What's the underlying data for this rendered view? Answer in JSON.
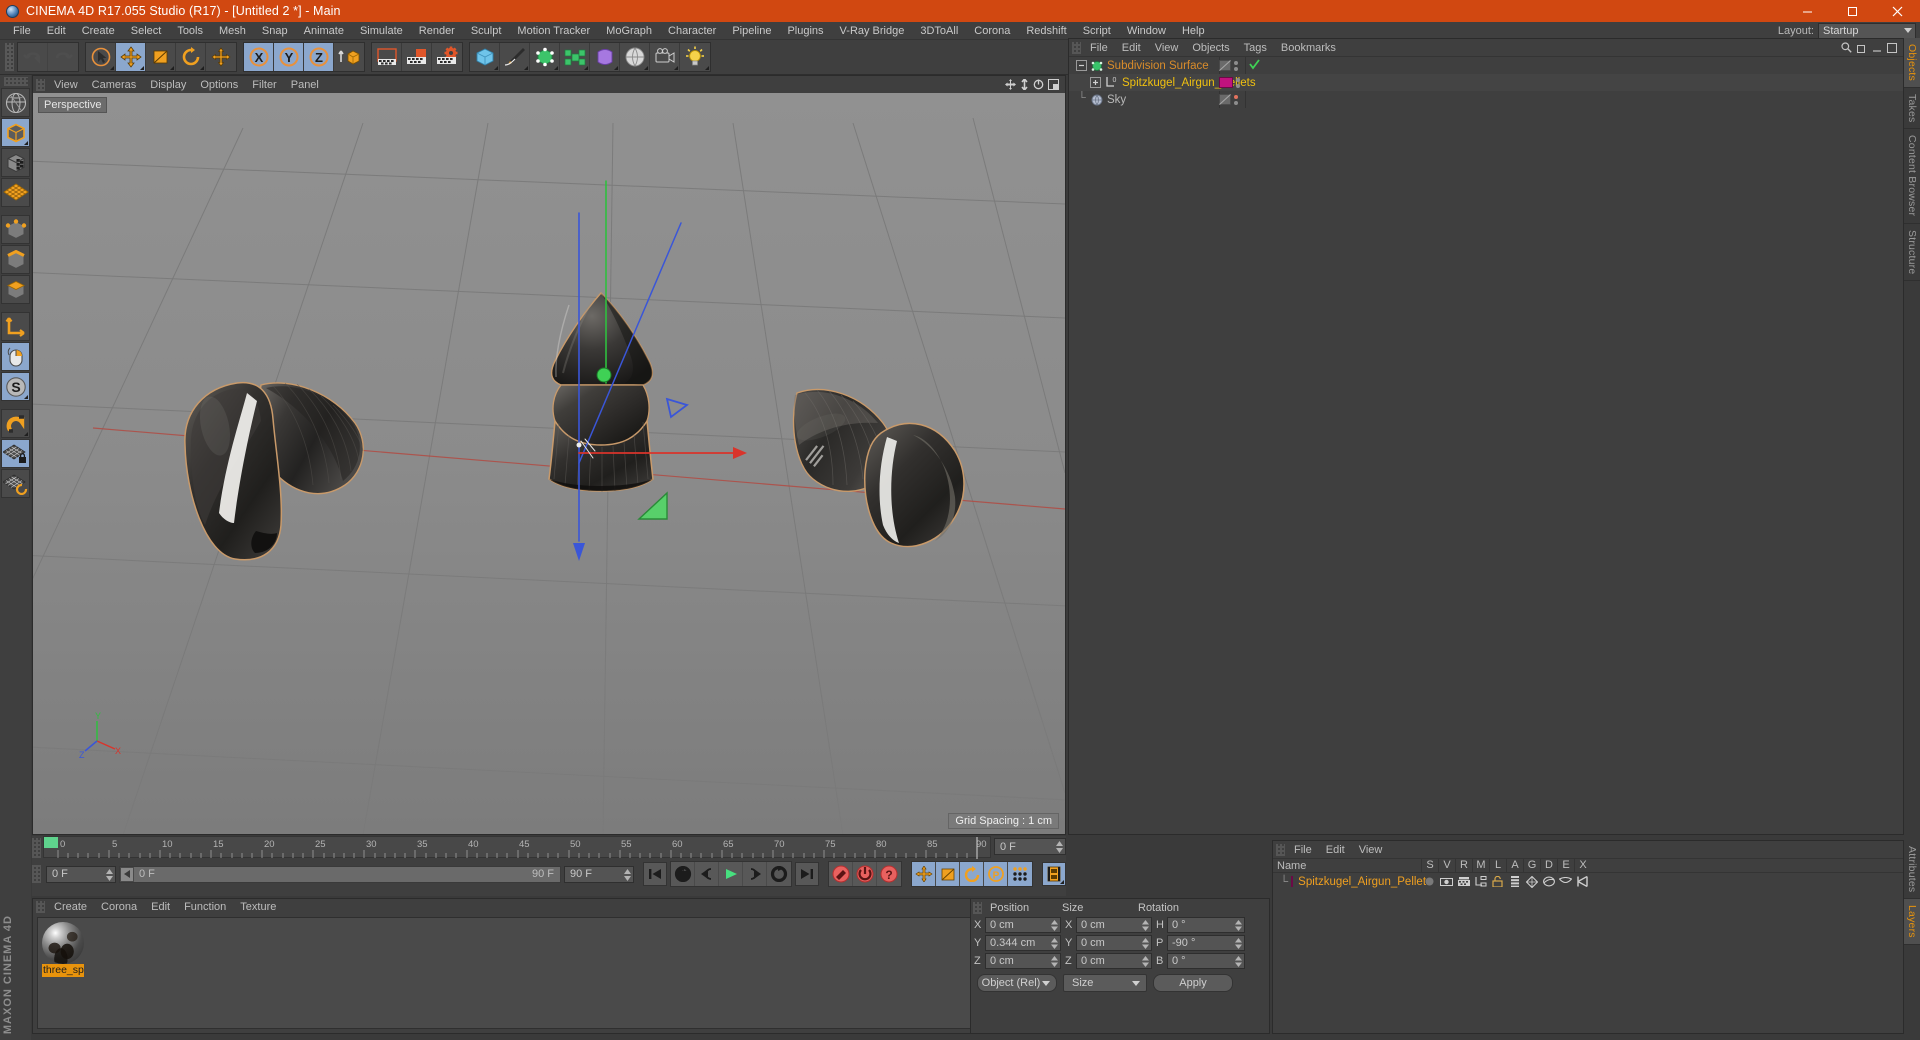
{
  "window": {
    "title": "CINEMA 4D R17.055 Studio (R17) - [Untitled 2 *] - Main",
    "logo_icon": "cinema4d-logo-icon",
    "minimize_icon": "minimize-icon",
    "maximize_icon": "maximize-icon",
    "close_icon": "close-icon",
    "titlebar_color": "#d14811"
  },
  "menubar": {
    "items": [
      {
        "label": "File"
      },
      {
        "label": "Edit"
      },
      {
        "label": "Create"
      },
      {
        "label": "Select"
      },
      {
        "label": "Tools"
      },
      {
        "label": "Mesh"
      },
      {
        "label": "Snap"
      },
      {
        "label": "Animate"
      },
      {
        "label": "Simulate"
      },
      {
        "label": "Render"
      },
      {
        "label": "Sculpt"
      },
      {
        "label": "Motion Tracker"
      },
      {
        "label": "MoGraph"
      },
      {
        "label": "Character"
      },
      {
        "label": "Pipeline"
      },
      {
        "label": "Plugins"
      },
      {
        "label": "V-Ray Bridge"
      },
      {
        "label": "3DToAll"
      },
      {
        "label": "Corona"
      },
      {
        "label": "Redshift"
      },
      {
        "label": "Script"
      },
      {
        "label": "Window"
      },
      {
        "label": "Help"
      }
    ],
    "layout_label": "Layout:",
    "layout_value": "Startup"
  },
  "toolbar": {
    "groups": [
      {
        "buttons": [
          {
            "name": "undo-button",
            "icon": "undo-icon",
            "selected": false,
            "dim": true
          },
          {
            "name": "redo-button",
            "icon": "redo-icon",
            "selected": false,
            "dim": true
          }
        ]
      },
      {
        "buttons": [
          {
            "name": "live-selection-tool",
            "icon": "cursor-circle-icon",
            "selected": false
          },
          {
            "name": "move-tool",
            "icon": "move-arrows-icon",
            "selected": true
          },
          {
            "name": "scale-tool",
            "icon": "scale-box-icon",
            "selected": false
          },
          {
            "name": "rotate-tool",
            "icon": "rotate-icon",
            "selected": false
          },
          {
            "name": "move-alt-tool",
            "icon": "move-arrows-icon",
            "selected": false
          }
        ]
      },
      {
        "buttons": [
          {
            "name": "lock-x-axis-button",
            "icon": "axis-x-icon",
            "selected": true
          },
          {
            "name": "lock-y-axis-button",
            "icon": "axis-y-icon",
            "selected": true
          },
          {
            "name": "lock-z-axis-button",
            "icon": "axis-z-icon",
            "selected": true
          },
          {
            "name": "world-object-coordinates-button",
            "icon": "world-cube-icon",
            "selected": false
          }
        ]
      },
      {
        "buttons": [
          {
            "name": "render-view-button",
            "icon": "render-clapper-icon",
            "selected": false
          },
          {
            "name": "render-to-picture-viewer-button",
            "icon": "render-picture-icon",
            "selected": false
          },
          {
            "name": "render-settings-button",
            "icon": "render-settings-icon",
            "selected": false
          }
        ]
      },
      {
        "buttons": [
          {
            "name": "add-cube-button",
            "icon": "cube-icon",
            "selected": false
          },
          {
            "name": "add-spline-button",
            "icon": "pen-spline-icon",
            "selected": false
          },
          {
            "name": "add-generator-button",
            "icon": "generator-icon",
            "selected": false
          },
          {
            "name": "add-array-button",
            "icon": "array-icon",
            "selected": false
          },
          {
            "name": "add-deformer-button",
            "icon": "deformer-icon",
            "selected": false
          },
          {
            "name": "add-environment-button",
            "icon": "environment-icon",
            "selected": false
          },
          {
            "name": "add-camera-button",
            "icon": "camera-icon",
            "selected": false
          },
          {
            "name": "add-light-button",
            "icon": "light-bulb-icon",
            "selected": false
          }
        ]
      }
    ]
  },
  "left_tools": {
    "buttons": [
      {
        "name": "make-editable-button",
        "icon": "globe-wire-icon",
        "selected": false
      },
      {
        "name": "model-mode-button",
        "icon": "model-cube-icon",
        "selected": true
      },
      {
        "name": "texture-mode-button",
        "icon": "texture-cube-icon",
        "selected": false
      },
      {
        "name": "workplane-mode-button",
        "icon": "workplane-grid-icon",
        "selected": false
      },
      {
        "name": "point-mode-button",
        "icon": "points-cube-icon",
        "selected": false
      },
      {
        "name": "edge-mode-button",
        "icon": "edge-cube-icon",
        "selected": false
      },
      {
        "name": "polygon-mode-button",
        "icon": "polygon-cube-icon",
        "selected": false
      },
      {
        "name": "axis-mode-button",
        "icon": "axis-corner-icon",
        "selected": false
      },
      {
        "name": "viewport-solo-button",
        "icon": "mouse-icon",
        "selected": true
      },
      {
        "name": "scale-snap-button",
        "icon": "s-circle-icon",
        "selected": true
      },
      {
        "name": "magnet-tool-button",
        "icon": "magnet-icon",
        "selected": false
      },
      {
        "name": "workplane-lock-button",
        "icon": "grid-lock-icon",
        "selected": true
      },
      {
        "name": "workplane-rotate-button",
        "icon": "grid-rotate-icon",
        "selected": false
      }
    ],
    "brand": "MAXON CINEMA 4D"
  },
  "viewport": {
    "menu_items": [
      {
        "label": "View"
      },
      {
        "label": "Cameras"
      },
      {
        "label": "Display"
      },
      {
        "label": "Options"
      },
      {
        "label": "Filter"
      },
      {
        "label": "Panel"
      }
    ],
    "label": "Perspective",
    "grid_spacing": "Grid Spacing : 1 cm",
    "axis_labels": {
      "y": "Y",
      "x": "X",
      "z": "Z"
    },
    "corner_icons": [
      "viewport-move-icon",
      "viewport-zoom-icon",
      "viewport-rotate-icon",
      "viewport-maximize-icon"
    ]
  },
  "object_manager": {
    "menu_items": [
      {
        "label": "File"
      },
      {
        "label": "Edit"
      },
      {
        "label": "View"
      },
      {
        "label": "Objects"
      },
      {
        "label": "Tags"
      },
      {
        "label": "Bookmarks"
      }
    ],
    "header_icons": [
      "search-icon",
      "window-restore-icon",
      "window-minimize-icon",
      "window-maximize-icon"
    ],
    "rows": [
      {
        "name": "Subdivision Surface",
        "icon": "subdivision-surface-icon",
        "color": "#d98c2b",
        "indent": 6,
        "expanded": true,
        "tag_color": "none",
        "check": true
      },
      {
        "name": "Spitzkugel_Airgun_Pellets",
        "icon": "object-layer0-icon",
        "color": "#f0c010",
        "indent": 22,
        "expanded": false,
        "tag_color": "#c0127e",
        "check": false
      },
      {
        "name": "Sky",
        "icon": "sky-sphere-icon",
        "color": "#b8b8b8",
        "indent": 22,
        "expanded": false,
        "tag_color": "none",
        "check": false
      }
    ]
  },
  "timeline": {
    "ruler_ticks": [
      0,
      5,
      10,
      15,
      20,
      25,
      30,
      35,
      40,
      45,
      50,
      55,
      60,
      65,
      70,
      75,
      80,
      85,
      90
    ],
    "current_frame_field": "0 F",
    "end_frame_field": "90 F",
    "preview_range_field": "90 F",
    "scrub_value": "0 F",
    "transport_buttons": [
      {
        "name": "go-to-start-button",
        "icon": "skip-start-icon"
      },
      {
        "name": "previous-keyframe-button",
        "icon": "prev-key-icon"
      },
      {
        "name": "step-back-button",
        "icon": "step-back-icon"
      },
      {
        "name": "play-button",
        "icon": "play-icon"
      },
      {
        "name": "step-forward-button",
        "icon": "step-forward-icon"
      },
      {
        "name": "next-keyframe-button",
        "icon": "next-key-icon"
      },
      {
        "name": "go-to-end-button",
        "icon": "skip-end-icon"
      }
    ],
    "record_buttons": [
      {
        "name": "record-active-objects-button",
        "icon": "record-key-icon"
      },
      {
        "name": "autokeying-button",
        "icon": "autokey-icon"
      },
      {
        "name": "keyframe-selection-button",
        "icon": "key-question-icon"
      }
    ],
    "key_mode_buttons": [
      {
        "name": "position-key-button",
        "icon": "position-key-icon",
        "selected": true
      },
      {
        "name": "scale-key-button",
        "icon": "scale-key-icon",
        "selected": true
      },
      {
        "name": "rotation-key-button",
        "icon": "rotation-key-icon",
        "selected": true
      },
      {
        "name": "parameter-key-button",
        "icon": "param-key-icon",
        "selected": true
      },
      {
        "name": "point-level-animation-button",
        "icon": "pla-dots-icon",
        "selected": true
      }
    ],
    "extra_button": {
      "name": "timeline-button",
      "icon": "timeline-film-icon"
    }
  },
  "material_manager": {
    "menu_items": [
      {
        "label": "Create"
      },
      {
        "label": "Corona"
      },
      {
        "label": "Edit"
      },
      {
        "label": "Function"
      },
      {
        "label": "Texture"
      }
    ],
    "materials": [
      {
        "name": "three_sp",
        "full_name": "three_sp",
        "preview_icon": "material-sphere-preview",
        "selected": true
      }
    ]
  },
  "coordinates": {
    "columns": [
      "Position",
      "Size",
      "Rotation"
    ],
    "rows": [
      {
        "p_label": "X",
        "p_value": "0 cm",
        "s_label": "X",
        "s_value": "0 cm",
        "r_label": "H",
        "r_value": "0 °"
      },
      {
        "p_label": "Y",
        "p_value": "0.344 cm",
        "s_label": "Y",
        "s_value": "0 cm",
        "r_label": "P",
        "r_value": "-90 °"
      },
      {
        "p_label": "Z",
        "p_value": "0 cm",
        "s_label": "Z",
        "s_value": "0 cm",
        "r_label": "B",
        "r_value": "0 °"
      }
    ],
    "mode_select": "Object (Rel)",
    "size_select": "Size",
    "apply_button": "Apply"
  },
  "layers": {
    "menu_items": [
      {
        "label": "File"
      },
      {
        "label": "Edit"
      },
      {
        "label": "View"
      }
    ],
    "name_column": "Name",
    "columns": [
      "S",
      "V",
      "R",
      "M",
      "L",
      "A",
      "G",
      "D",
      "E",
      "X"
    ],
    "rows": [
      {
        "name": "Spitzkugel_Airgun_Pellets",
        "color": "#c0127e",
        "text_color": "#f0a020"
      }
    ]
  },
  "right_tabs": {
    "top": [
      {
        "label": "Objects",
        "active": true
      },
      {
        "label": "Takes",
        "active": false
      },
      {
        "label": "Content Browser",
        "active": false
      },
      {
        "label": "Structure",
        "active": false
      }
    ],
    "bottom": [
      {
        "label": "Attributes",
        "active": false
      },
      {
        "label": "Layers",
        "active": true
      }
    ]
  }
}
